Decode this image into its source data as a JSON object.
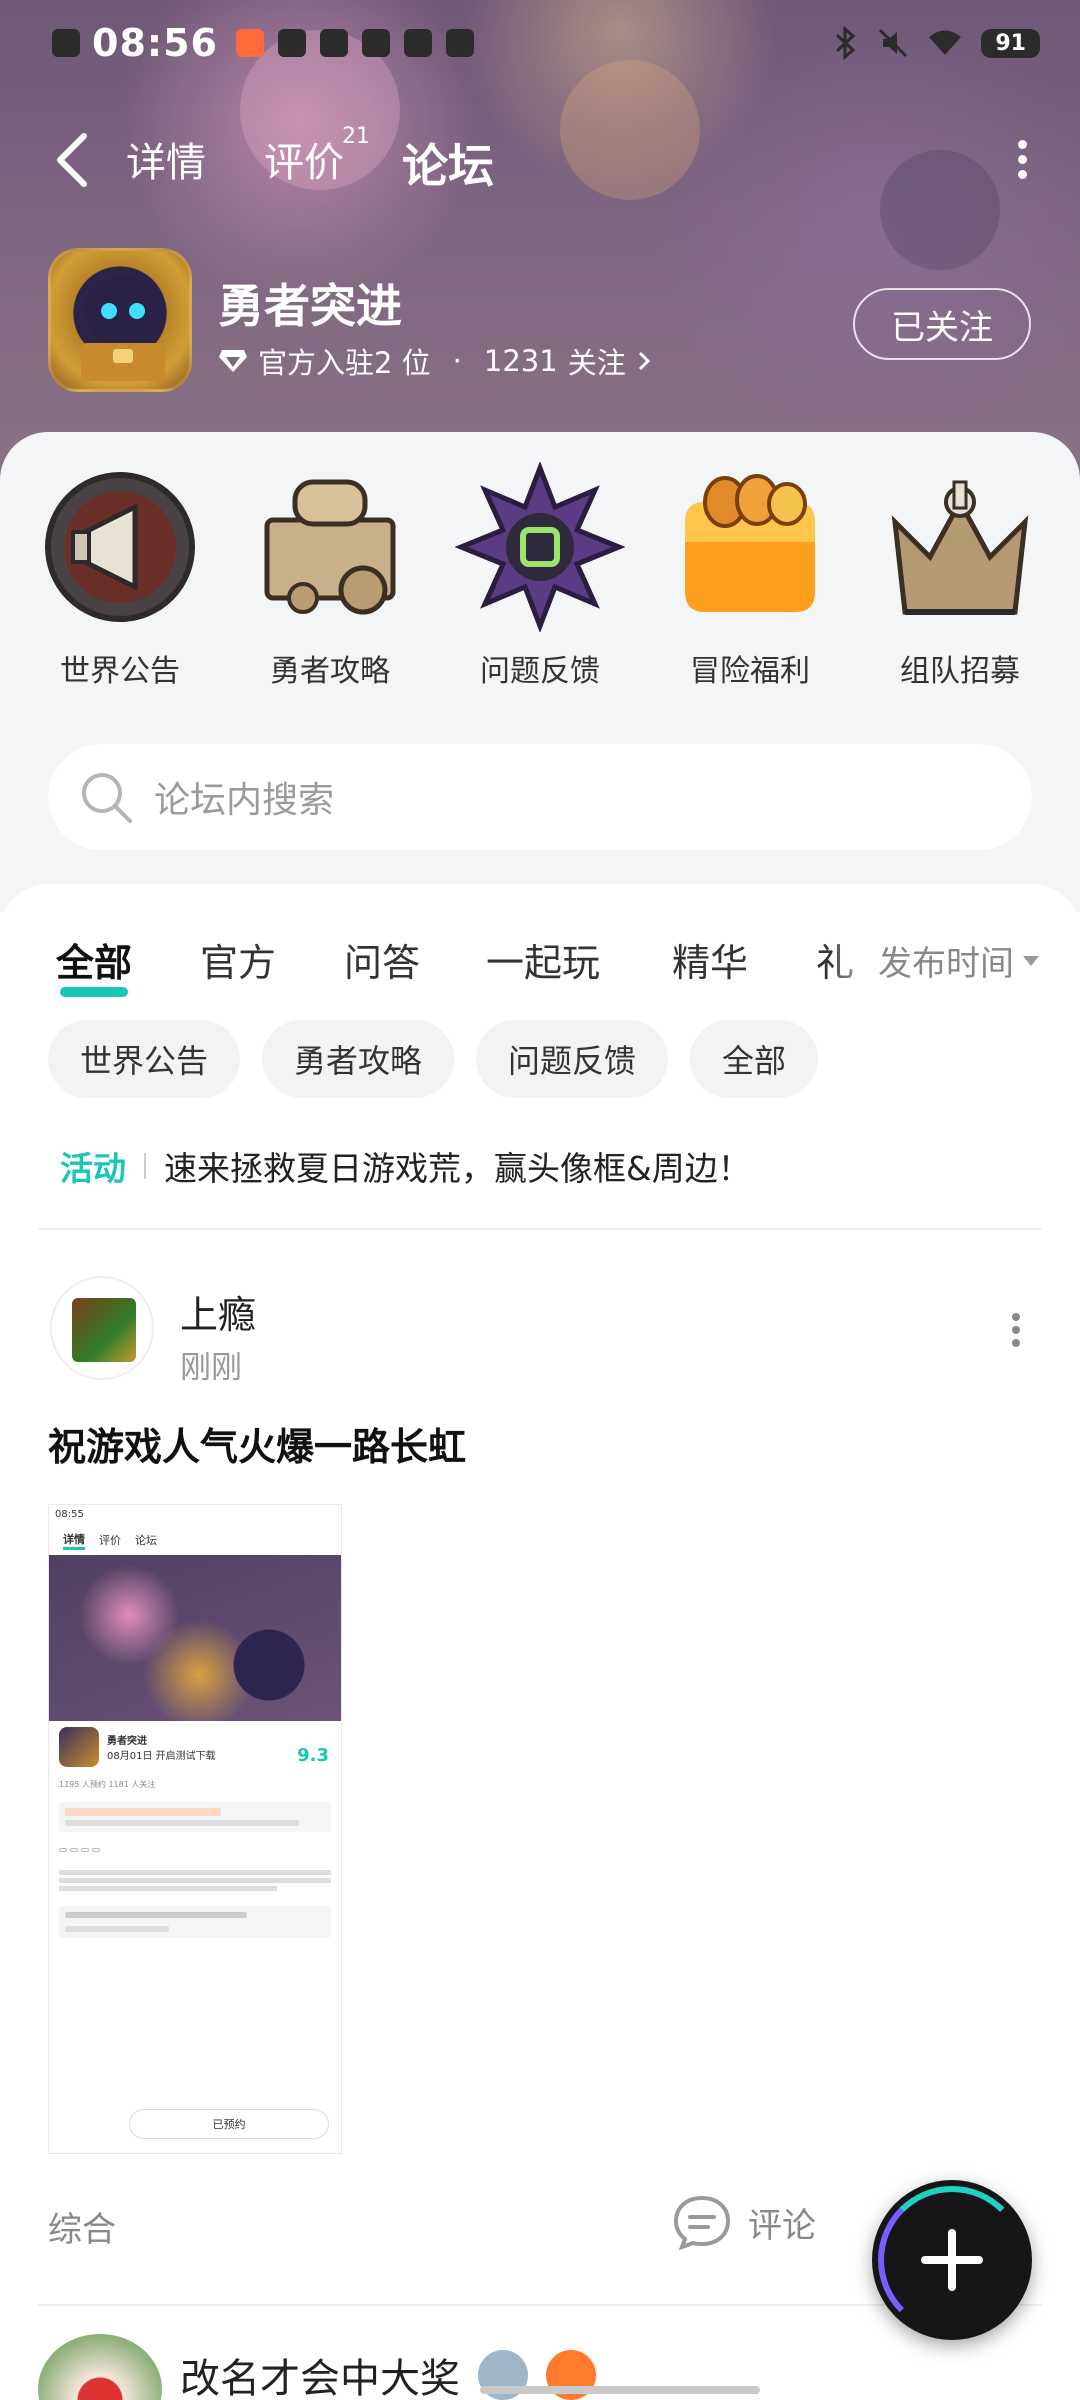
{
  "status_bar": {
    "time": "08:56",
    "battery": "91"
  },
  "nav": {
    "tabs": [
      {
        "label": "详情"
      },
      {
        "label": "评价",
        "badge": "21"
      },
      {
        "label": "论坛"
      }
    ],
    "active_tab": "论坛"
  },
  "game": {
    "title": "勇者突进",
    "official_label": "官方入驻2 位",
    "separator": "·",
    "followers": "1231",
    "followers_suffix": "关注",
    "follow_button": "已关注"
  },
  "categories": [
    {
      "label": "世界公告",
      "icon": "megaphone-icon"
    },
    {
      "label": "勇者攻略",
      "icon": "treasure-map-icon"
    },
    {
      "label": "问题反馈",
      "icon": "spiked-gem-icon"
    },
    {
      "label": "冒险福利",
      "icon": "jelly-cake-icon"
    },
    {
      "label": "组队招募",
      "icon": "crown-icon"
    }
  ],
  "search": {
    "placeholder": "论坛内搜索"
  },
  "filter_tabs": [
    "全部",
    "官方",
    "问答",
    "一起玩",
    "精华",
    "礼"
  ],
  "sort": {
    "label": "发布时间"
  },
  "chips": [
    "世界公告",
    "勇者攻略",
    "问题反馈",
    "全部"
  ],
  "activity": {
    "tag": "活动",
    "text": "速来拯救夏日游戏荒，赢头像框&周边！"
  },
  "post": {
    "user": "上瘾",
    "time": "刚刚",
    "title": "祝游戏人气火爆一路长虹",
    "category": "综合",
    "comment_label": "评论",
    "screenshot": {
      "time": "08:55",
      "tabs": [
        "详情",
        "评价",
        "论坛"
      ],
      "game_title": "勇者突进",
      "date": "08月01日 开启测试下载",
      "score": "9.3",
      "stats": "1195 人预约    1181 人关注",
      "button": "已预约"
    }
  },
  "post2": {
    "user": "改名才会中大奖"
  },
  "colors": {
    "accent": "#19c6b8",
    "hero": "#7d6680"
  }
}
